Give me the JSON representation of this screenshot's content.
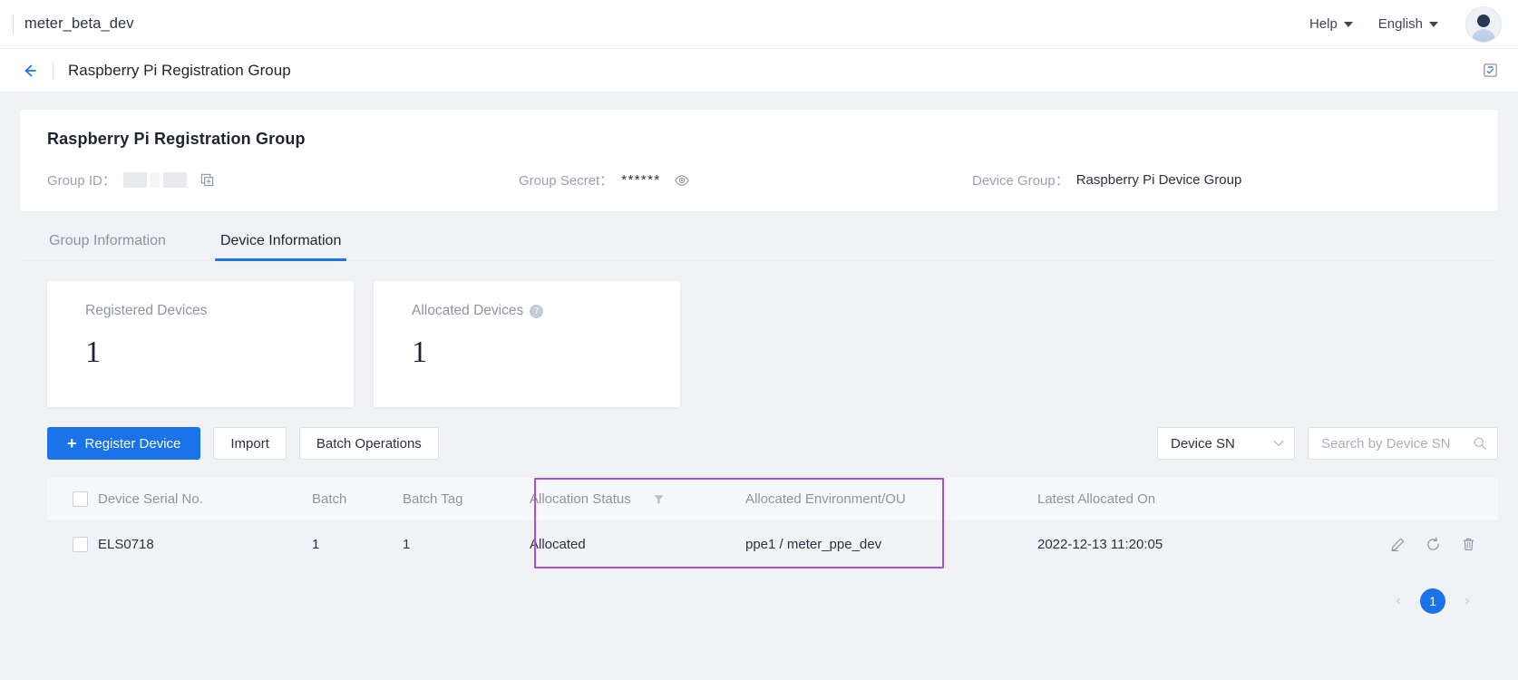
{
  "topbar": {
    "tenant": "meter_beta_dev",
    "help_label": "Help",
    "language_label": "English"
  },
  "pageheader": {
    "title": "Raspberry Pi Registration Group"
  },
  "info_card": {
    "title": "Raspberry Pi Registration Group",
    "group_id_label": "Group ID：",
    "group_id_value": "",
    "group_secret_label": "Group Secret：",
    "group_secret_value": "******",
    "device_group_label": "Device Group：",
    "device_group_value": "Raspberry Pi Device Group"
  },
  "tabs": [
    {
      "label": "Group Information",
      "active": false
    },
    {
      "label": "Device Information",
      "active": true
    }
  ],
  "stats": [
    {
      "label": "Registered Devices",
      "value": "1",
      "has_help": false
    },
    {
      "label": "Allocated Devices",
      "value": "1",
      "has_help": true,
      "help_glyph": "?"
    }
  ],
  "actions": {
    "register_device": "Register Device",
    "register_device_plus": "+",
    "import": "Import",
    "batch_operations": "Batch Operations"
  },
  "filters": {
    "select_value": "Device SN",
    "search_placeholder": "Search by Device SN"
  },
  "table": {
    "columns": [
      "Device Serial No.",
      "Batch",
      "Batch Tag",
      "Allocation Status",
      "Allocated Environment/OU",
      "Latest Allocated On"
    ],
    "rows": [
      {
        "serial": "ELS0718",
        "batch": "1",
        "batch_tag": "1",
        "allocation_status": "Allocated",
        "environment_ou": "ppe1 / meter_ppe_dev",
        "latest_allocated_on": "2022-12-13 11:20:05"
      }
    ]
  },
  "pagination": {
    "prev": "‹",
    "current_page": "1",
    "next": "›"
  },
  "colors": {
    "primary_blue": "#1a73e8",
    "highlight_purple": "#b44ae0",
    "muted_text": "#8d94a1"
  }
}
